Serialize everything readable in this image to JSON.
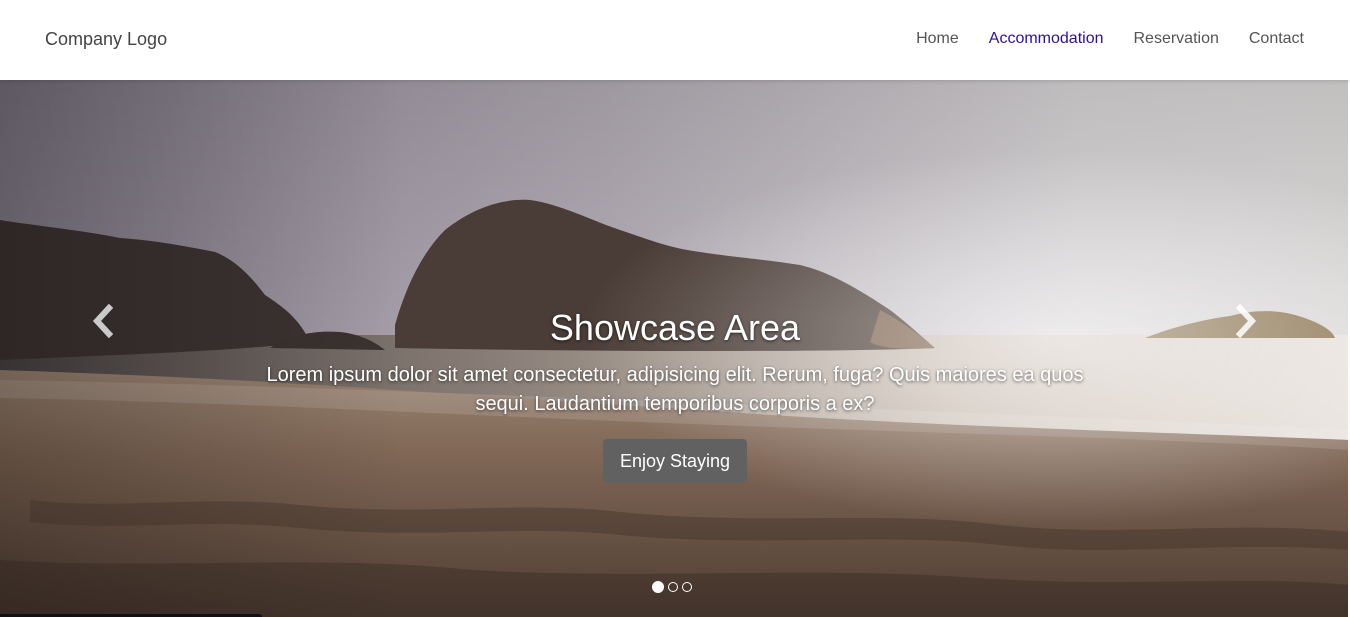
{
  "navbar": {
    "brand": "Company Logo",
    "links": [
      {
        "label": "Home",
        "active": false
      },
      {
        "label": "Accommodation",
        "active": true
      },
      {
        "label": "Reservation",
        "active": false
      },
      {
        "label": "Contact",
        "active": false
      }
    ],
    "active_color": "#2b10a8"
  },
  "showcase": {
    "title": "Showcase Area",
    "text": "Lorem ipsum dolor sit amet consectetur, adipisicing elit. Rerum, fuga? Quis maiores ea quos sequi. Laudantium temporibus corporis a ex?",
    "button_label": "Enjoy Staying",
    "prev_icon": "chevron-left-icon",
    "next_icon": "chevron-right-icon",
    "slides": [
      {
        "active": true
      },
      {
        "active": false
      },
      {
        "active": false
      }
    ]
  }
}
